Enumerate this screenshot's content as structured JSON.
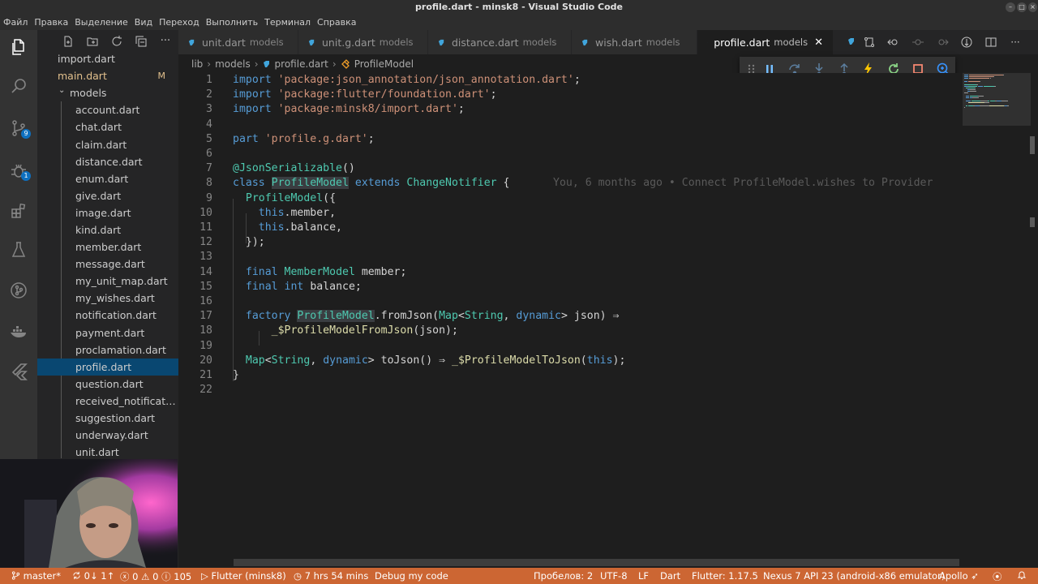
{
  "window": {
    "title": "profile.dart - minsk8 - Visual Studio Code"
  },
  "menu": [
    "Файл",
    "Правка",
    "Выделение",
    "Вид",
    "Переход",
    "Выполнить",
    "Терминал",
    "Справка"
  ],
  "activity_bar": {
    "icons": [
      "files-icon",
      "search-icon",
      "source-control-icon",
      "debug-icon",
      "extensions-icon",
      "testing-icon",
      "git-graph-icon",
      "docker-icon",
      "flutter-icon"
    ],
    "source_control_badge": "9",
    "debug_badge": "1"
  },
  "explorer": {
    "files": [
      {
        "label": "import.dart",
        "type": "file"
      },
      {
        "label": "main.dart",
        "type": "file",
        "modified": true,
        "badge": "M"
      },
      {
        "label": "models",
        "type": "folder"
      },
      {
        "label": "account.dart",
        "type": "file"
      },
      {
        "label": "chat.dart",
        "type": "file"
      },
      {
        "label": "claim.dart",
        "type": "file"
      },
      {
        "label": "distance.dart",
        "type": "file"
      },
      {
        "label": "enum.dart",
        "type": "file"
      },
      {
        "label": "give.dart",
        "type": "file"
      },
      {
        "label": "image.dart",
        "type": "file"
      },
      {
        "label": "kind.dart",
        "type": "file"
      },
      {
        "label": "member.dart",
        "type": "file"
      },
      {
        "label": "message.dart",
        "type": "file"
      },
      {
        "label": "my_unit_map.dart",
        "type": "file"
      },
      {
        "label": "my_wishes.dart",
        "type": "file"
      },
      {
        "label": "notification.dart",
        "type": "file"
      },
      {
        "label": "payment.dart",
        "type": "file"
      },
      {
        "label": "proclamation.dart",
        "type": "file"
      },
      {
        "label": "profile.dart",
        "type": "file",
        "selected": true
      },
      {
        "label": "question.dart",
        "type": "file"
      },
      {
        "label": "received_notificatio...",
        "type": "file"
      },
      {
        "label": "suggestion.dart",
        "type": "file"
      },
      {
        "label": "underway.dart",
        "type": "file"
      },
      {
        "label": "unit.dart",
        "type": "file"
      }
    ]
  },
  "tabs": [
    {
      "name": "unit.dart",
      "desc": "models",
      "active": false
    },
    {
      "name": "unit.g.dart",
      "desc": "models",
      "active": false
    },
    {
      "name": "distance.dart",
      "desc": "models",
      "active": false
    },
    {
      "name": "wish.dart",
      "desc": "models",
      "active": false
    },
    {
      "name": "profile.dart",
      "desc": "models",
      "active": true,
      "close": "✕"
    }
  ],
  "breadcrumb": {
    "items": [
      "lib",
      "models",
      "profile.dart",
      "ProfileModel"
    ],
    "separator": "›"
  },
  "editor": {
    "blame": "You, 6 months ago • Connect ProfileModel.wishes to Provider",
    "line_numbers": [
      "1",
      "2",
      "3",
      "4",
      "5",
      "6",
      "7",
      "8",
      "9",
      "10",
      "11",
      "12",
      "13",
      "14",
      "15",
      "16",
      "17",
      "18",
      "19",
      "20",
      "21",
      "22"
    ],
    "lines": [
      [
        {
          "t": "import",
          "c": "kw"
        },
        {
          "t": " "
        },
        {
          "t": "'package:json_annotation/json_annotation.dart'",
          "c": "str"
        },
        {
          "t": ";"
        }
      ],
      [
        {
          "t": "import",
          "c": "kw"
        },
        {
          "t": " "
        },
        {
          "t": "'package:flutter/foundation.dart'",
          "c": "str"
        },
        {
          "t": ";"
        }
      ],
      [
        {
          "t": "import",
          "c": "kw"
        },
        {
          "t": " "
        },
        {
          "t": "'package:minsk8/import.dart'",
          "c": "str"
        },
        {
          "t": ";"
        }
      ],
      [],
      [
        {
          "t": "part",
          "c": "kw"
        },
        {
          "t": " "
        },
        {
          "t": "'profile.g.dart'",
          "c": "str"
        },
        {
          "t": ";"
        }
      ],
      [],
      [
        {
          "t": "@JsonSerializable",
          "c": "ann"
        },
        {
          "t": "()"
        }
      ],
      [
        {
          "t": "class",
          "c": "kw"
        },
        {
          "t": " "
        },
        {
          "t": "ProfileModel",
          "c": "cls hl"
        },
        {
          "t": " "
        },
        {
          "t": "extends",
          "c": "kw"
        },
        {
          "t": " "
        },
        {
          "t": "ChangeNotifier",
          "c": "cls"
        },
        {
          "t": " {"
        }
      ],
      [
        {
          "t": "  "
        },
        {
          "t": "ProfileModel",
          "c": "cls"
        },
        {
          "t": "({"
        }
      ],
      [
        {
          "t": "    "
        },
        {
          "t": "this",
          "c": "kw"
        },
        {
          "t": ".member,"
        }
      ],
      [
        {
          "t": "    "
        },
        {
          "t": "this",
          "c": "kw"
        },
        {
          "t": ".balance,"
        }
      ],
      [
        {
          "t": "  });"
        }
      ],
      [],
      [
        {
          "t": "  "
        },
        {
          "t": "final",
          "c": "kw"
        },
        {
          "t": " "
        },
        {
          "t": "MemberModel",
          "c": "cls"
        },
        {
          "t": " member;"
        }
      ],
      [
        {
          "t": "  "
        },
        {
          "t": "final",
          "c": "kw"
        },
        {
          "t": " "
        },
        {
          "t": "int",
          "c": "kw"
        },
        {
          "t": " balance;"
        }
      ],
      [],
      [
        {
          "t": "  "
        },
        {
          "t": "factory",
          "c": "kw"
        },
        {
          "t": " "
        },
        {
          "t": "ProfileModel",
          "c": "cls hl"
        },
        {
          "t": ".fromJson("
        },
        {
          "t": "Map",
          "c": "cls"
        },
        {
          "t": "<"
        },
        {
          "t": "String",
          "c": "cls"
        },
        {
          "t": ", "
        },
        {
          "t": "dynamic",
          "c": "kw"
        },
        {
          "t": "> json) ⇒"
        }
      ],
      [
        {
          "t": "      "
        },
        {
          "t": "_$ProfileModelFromJson",
          "c": "fn"
        },
        {
          "t": "(json);"
        }
      ],
      [],
      [
        {
          "t": "  "
        },
        {
          "t": "Map",
          "c": "cls"
        },
        {
          "t": "<"
        },
        {
          "t": "String",
          "c": "cls"
        },
        {
          "t": ", "
        },
        {
          "t": "dynamic",
          "c": "kw"
        },
        {
          "t": "> toJson() ⇒ "
        },
        {
          "t": "_$ProfileModelToJson",
          "c": "fn"
        },
        {
          "t": "("
        },
        {
          "t": "this",
          "c": "kw"
        },
        {
          "t": ");"
        }
      ],
      [
        {
          "t": "}"
        }
      ],
      []
    ]
  },
  "status_bar": {
    "branch": "master*",
    "sync": "0↓ 1↑",
    "errors": "0",
    "warnings": "0",
    "info": "105",
    "launch": "Flutter (minsk8)",
    "time": "7 hrs 54 mins",
    "debug": "Debug my code",
    "spaces": "Пробелов: 2",
    "encoding": "UTF-8",
    "eol": "LF",
    "language": "Dart",
    "flutter": "Flutter: 1.17.5",
    "device": "Nexus 7 API 23 (android-x86 emulator)",
    "apollo": "Apollo"
  },
  "colors": {
    "status_bar": "#cc6633",
    "selection": "#094771",
    "accent": "#0e70c0"
  }
}
